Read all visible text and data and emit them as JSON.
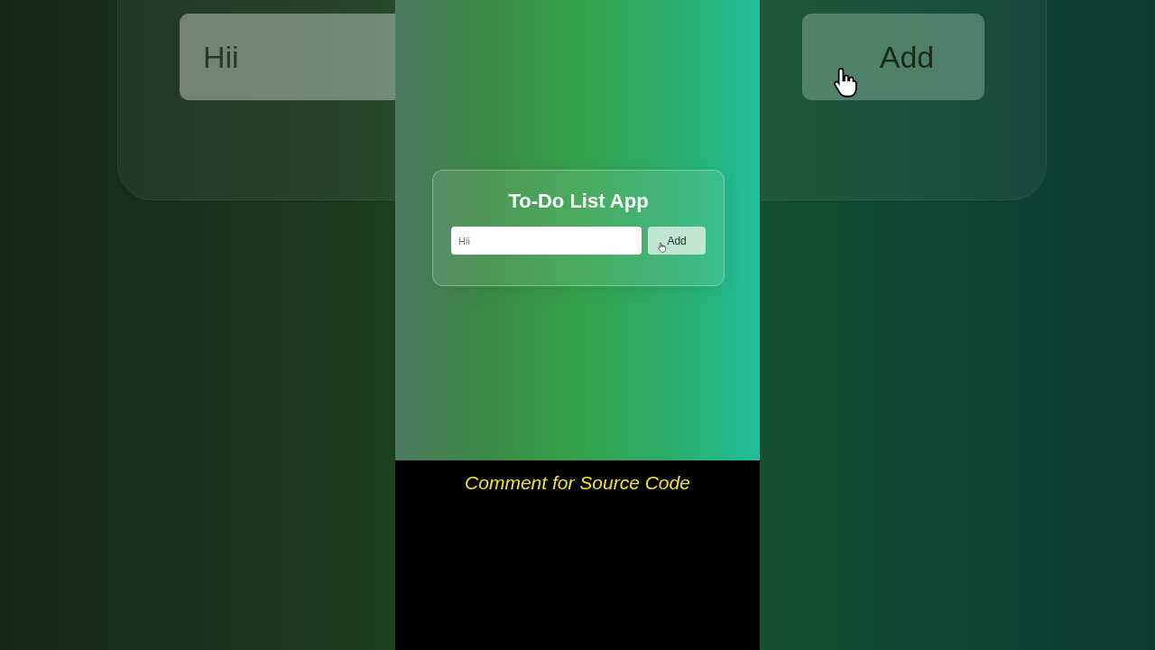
{
  "backdrop": {
    "input": {
      "value": "Hii"
    },
    "button": {
      "label": "Add"
    }
  },
  "app": {
    "title": "To-Do List App",
    "input": {
      "value": "Hii"
    },
    "button": {
      "label": "Add"
    }
  },
  "caption": "Comment for Source Code"
}
